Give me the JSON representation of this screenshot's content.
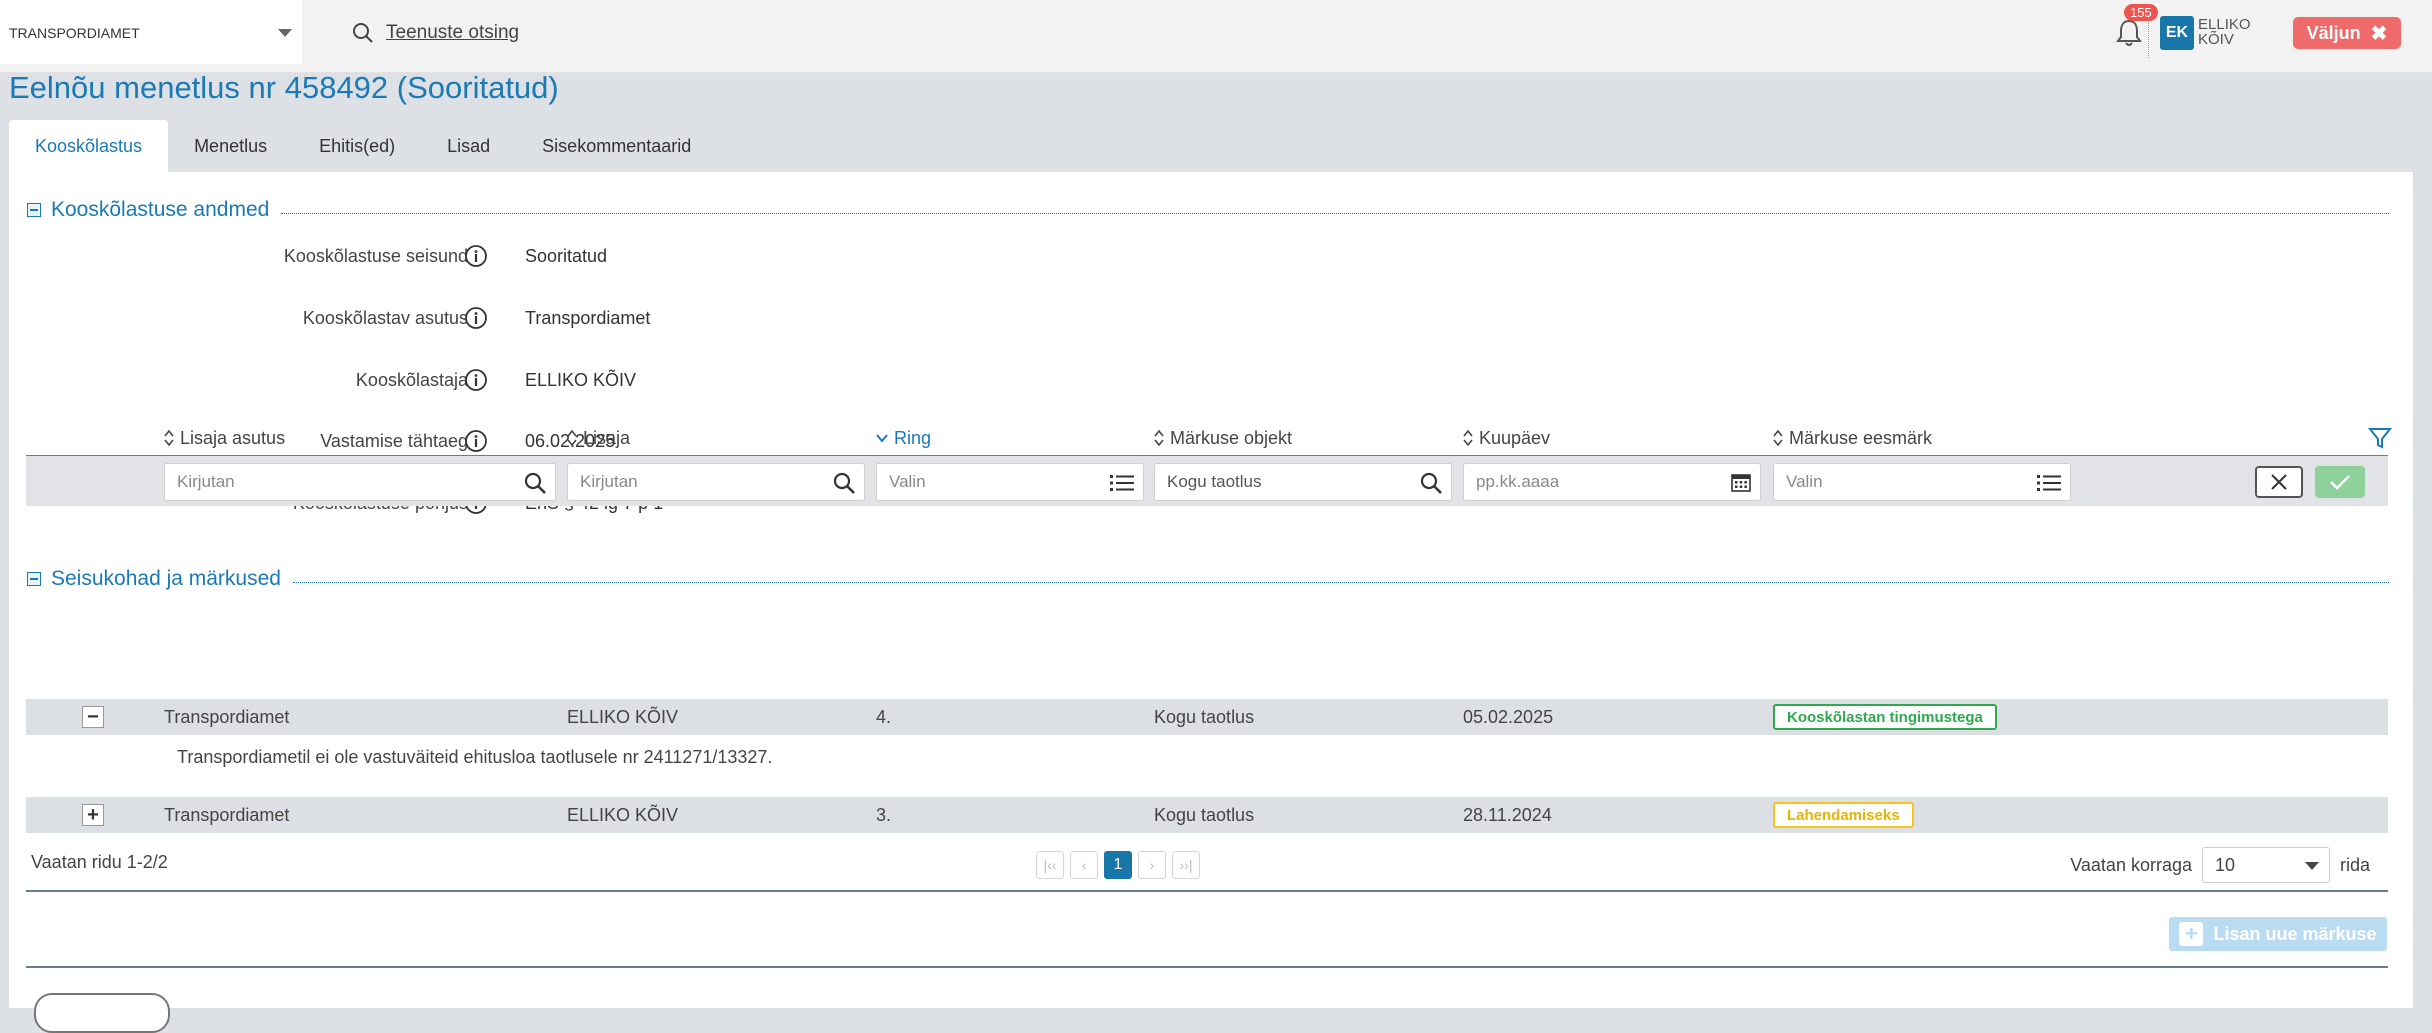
{
  "header": {
    "org_select": "TRANSPORDIAMET",
    "search_link": "Teenuste otsing",
    "notification_count": "155",
    "user_initials": "EK",
    "user_name": "ELLIKO KÕIV",
    "logout_label": "Väljun"
  },
  "page": {
    "title": "Eelnõu menetlus nr 458492 (Sooritatud)",
    "tabs": [
      {
        "label": "Kooskõlastus",
        "active": true
      },
      {
        "label": "Menetlus",
        "active": false
      },
      {
        "label": "Ehitis(ed)",
        "active": false
      },
      {
        "label": "Lisad",
        "active": false
      },
      {
        "label": "Sisekommentaarid",
        "active": false
      }
    ]
  },
  "section1": {
    "title": "Kooskõlastuse andmed",
    "fields": [
      {
        "label": "Kooskõlastuse seisund",
        "value": "Sooritatud"
      },
      {
        "label": "Kooskõlastav asutus",
        "value": "Transpordiamet"
      },
      {
        "label": "Kooskõlastaja",
        "value": "ELLIKO KÕIV"
      },
      {
        "label": "Vastamise tähtaeg",
        "value": "06.02.2025"
      },
      {
        "label": "Kooskõlastuse põhjus",
        "value": "EhS § 42 lg 7 p 1"
      }
    ]
  },
  "section2": {
    "title": "Seisukohad ja märkused",
    "columns": [
      "Lisaja asutus",
      "Lisaja",
      "Ring",
      "Märkuse objekt",
      "Kuupäev",
      "Märkuse eesmärk"
    ],
    "filters": {
      "lisaja_asutus": "Kirjutan",
      "lisaja": "Kirjutan",
      "ring": "Valin",
      "markuse_objekt": "Kogu taotlus",
      "kuupaev": "pp.kk.aaaa",
      "markuse_eesmark": "Valin"
    },
    "rows": [
      {
        "expander": "−",
        "asutus": "Transpordiamet",
        "lisaja": "ELLIKO KÕIV",
        "ring": "4.",
        "objekt": "Kogu taotlus",
        "kuupaev": "05.02.2025",
        "eesmark": "Kooskõlastan tingimustega",
        "detail": "Transpordiametil ei ole vastuväiteid ehitusloa taotlusele nr 2411271/13327."
      },
      {
        "expander": "+",
        "asutus": "Transpordiamet",
        "lisaja": "ELLIKO KÕIV",
        "ring": "3.",
        "objekt": "Kogu taotlus",
        "kuupaev": "28.11.2024",
        "eesmark": "Lahendamiseks"
      }
    ],
    "footer": {
      "rows_info": "Vaatan ridu 1-2/2",
      "current_page": "1",
      "per_page_label": "Vaatan korraga",
      "per_page_value": "10",
      "per_page_suffix": "rida"
    },
    "add_button": "Lisan uue märkuse"
  },
  "colors": {
    "accent": "#1a7ab5",
    "logout": "#ef6b6b",
    "badge_green": "#2eaa4f",
    "badge_yellow": "#f5c518"
  }
}
